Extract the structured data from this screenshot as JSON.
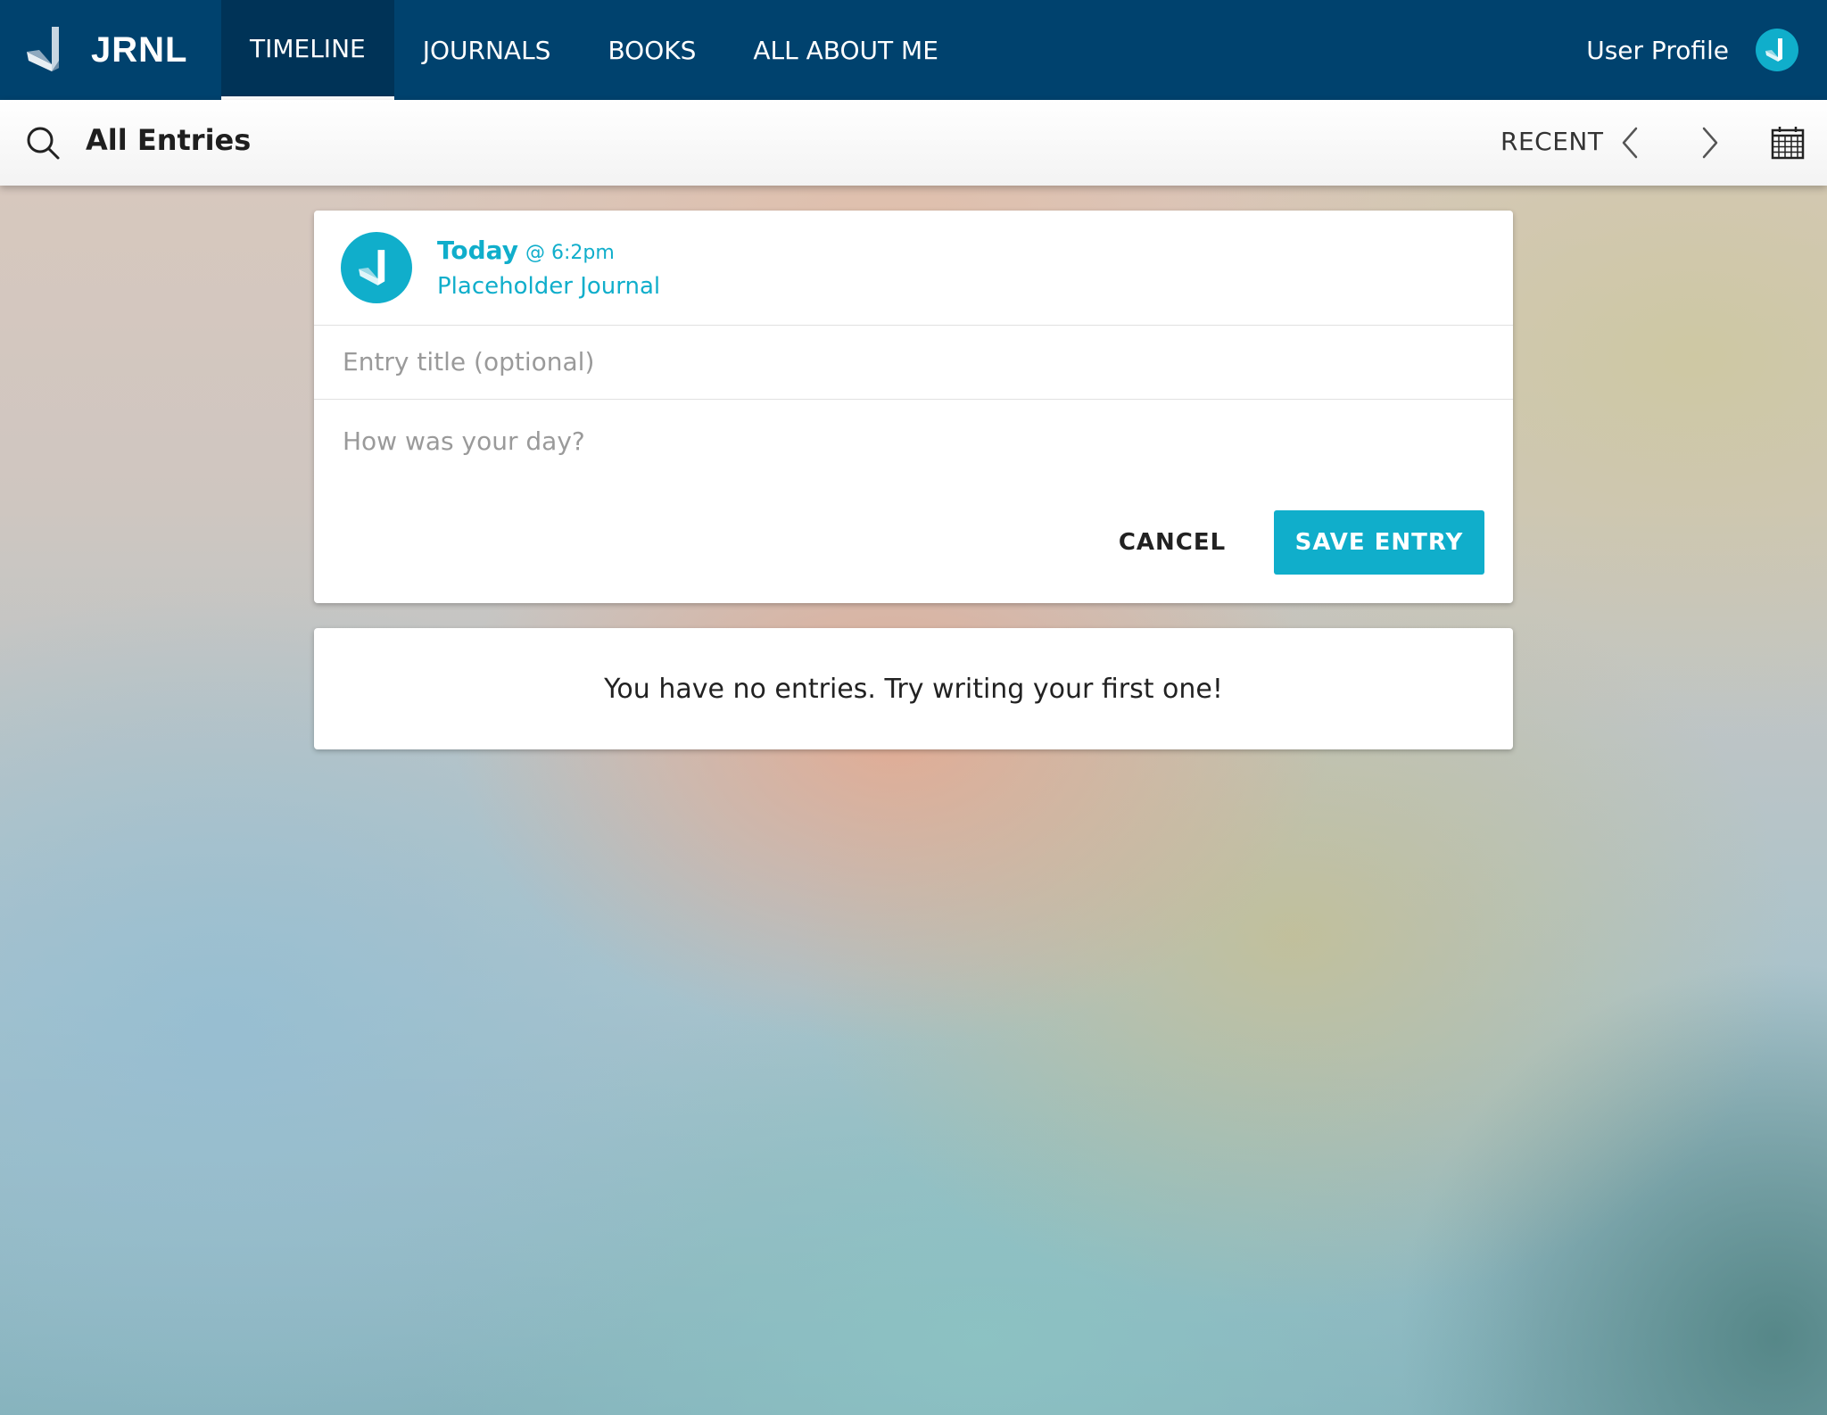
{
  "app": {
    "brand_name": "JRNL",
    "brand_icon": "jrnl-book-logo-icon"
  },
  "topnav": {
    "tabs": [
      {
        "label": "TIMELINE",
        "active": true
      },
      {
        "label": "JOURNALS",
        "active": false
      },
      {
        "label": "BOOKS",
        "active": false
      },
      {
        "label": "ALL ABOUT ME",
        "active": false
      }
    ],
    "user_label": "User Profile",
    "user_avatar_icon": "jrnl-book-logo-icon"
  },
  "toolbar": {
    "search_icon": "search-icon",
    "title": "All Entries",
    "sort_label": "RECENT",
    "prev_icon": "chevron-left-icon",
    "next_icon": "chevron-right-icon",
    "calendar_icon": "calendar-icon"
  },
  "entry_form": {
    "day": "Today",
    "time": "@ 6:2pm",
    "journal_name": "Placeholder Journal",
    "title_placeholder": "Entry title (optional)",
    "title_value": "",
    "body_placeholder": "How was your day?",
    "body_value": "",
    "cancel_label": "CANCEL",
    "save_label": "SAVE ENTRY"
  },
  "empty_state": {
    "message": "You have no entries. Try writing your first one!"
  },
  "colors": {
    "nav_background": "#00426e",
    "nav_active_tab": "#003357",
    "accent": "#10aecb",
    "card_background": "#ffffff"
  }
}
